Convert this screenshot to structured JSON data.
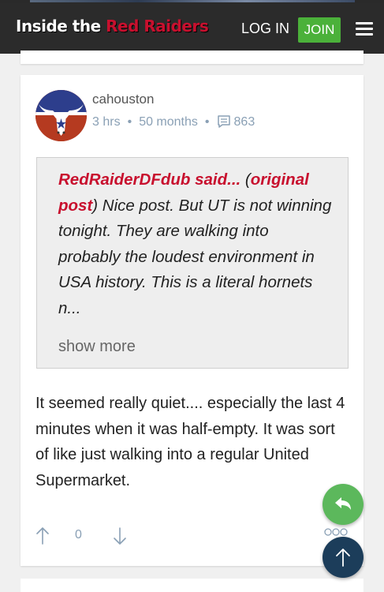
{
  "header": {
    "logo_part1": "Inside the ",
    "logo_part2": "Red Raiders",
    "login": "LOG IN",
    "join": "JOIN"
  },
  "post": {
    "username": "cahouston",
    "time": "3 hrs",
    "tenure": "50 months",
    "comment_count": "863",
    "quote": {
      "author": "RedRaiderDFdub said...",
      "open_paren": " (",
      "link_part1": "original",
      "link_part2": "post",
      "text": ") Nice post. But UT is not winning tonight. They are walking into probably the loudest environment in USA history. This is a literal hornets n...",
      "show_more": "show more"
    },
    "body": "It seemed really quiet.... especially the last 4 minutes when it was half-empty. It was sort of like just walking into a regular United Supermarket.",
    "score": "0"
  },
  "colors": {
    "header_bg": "#2b2b2b",
    "brand_red": "#c8102e",
    "join_green": "#4bb13a",
    "reply_green": "#5cb85c",
    "totop_navy": "#1c3d5a",
    "meta_blue": "#8aa0b5"
  }
}
